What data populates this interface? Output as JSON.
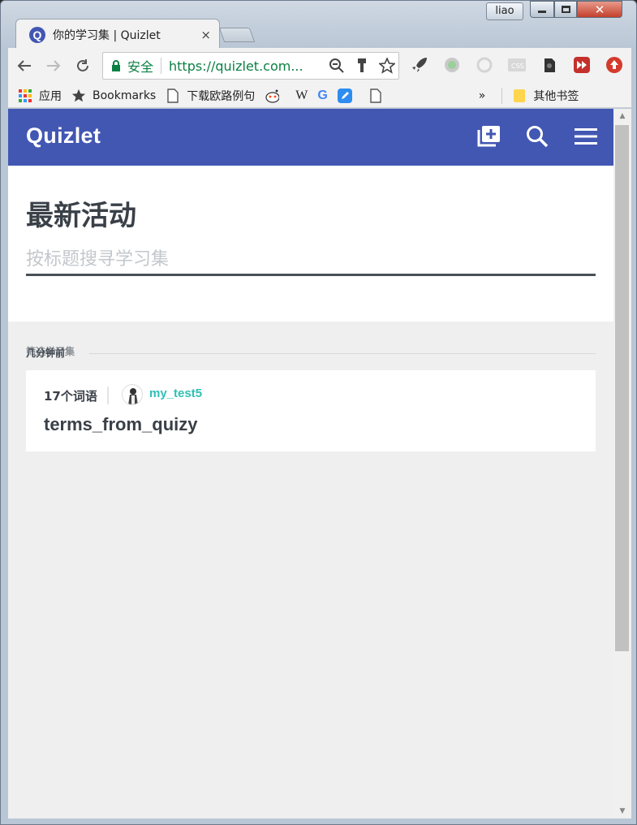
{
  "window": {
    "user_label": "liao",
    "close_glyph": "✕"
  },
  "tab": {
    "favicon_letter": "Q",
    "title": "你的学习集 | Quizlet",
    "close_glyph": "×"
  },
  "toolbar": {
    "secure_label": "安全",
    "url": "https://quizlet.com..."
  },
  "bookmarks": {
    "items": [
      {
        "label": "应用",
        "icon": "apps-grid-icon"
      },
      {
        "label": "Bookmarks",
        "icon": "star-icon"
      },
      {
        "label": "下载欧路例句",
        "icon": "page-icon"
      },
      {
        "label": "",
        "icon": "reddit-icon"
      },
      {
        "label": "W",
        "icon": "wikipedia-icon"
      },
      {
        "label": "G",
        "icon": "google-icon"
      },
      {
        "label": "",
        "icon": "pencil-app-icon"
      },
      {
        "label": "",
        "icon": "page-icon"
      }
    ],
    "overflow": "»",
    "other_label": "其他书签"
  },
  "site": {
    "logo": "Quizlet",
    "page_title": "最新活动",
    "search_placeholder": "按标题搜寻学习集",
    "search_value": "",
    "filter_label": "筛选学习集",
    "section_label": "几分钟前",
    "set": {
      "term_count": "17个词语",
      "username": "my_test5",
      "title": "terms_from_quizy"
    }
  },
  "colors": {
    "brand": "#4257b2",
    "username": "#30c0b4",
    "secure": "#0b8043"
  }
}
